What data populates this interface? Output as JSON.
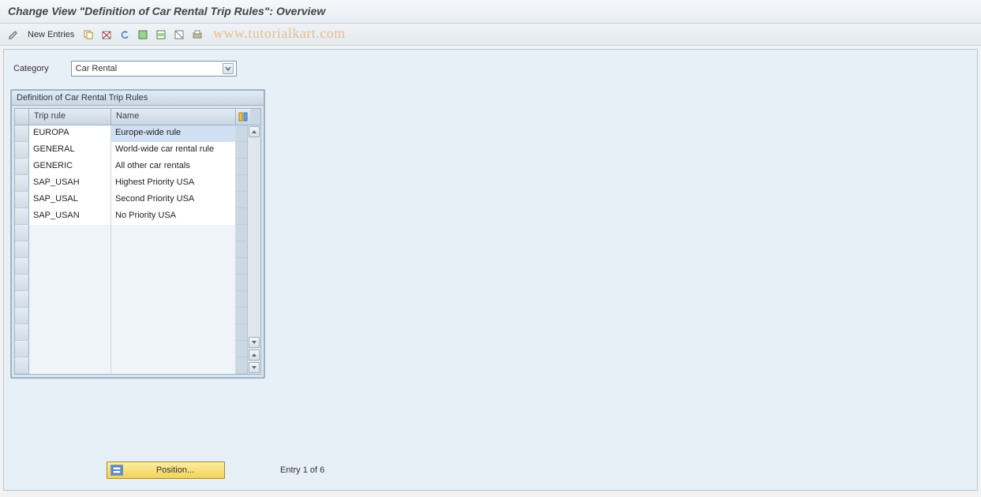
{
  "title": "Change View \"Definition of Car Rental Trip Rules\": Overview",
  "toolbar": {
    "new_entries": "New Entries"
  },
  "watermark": "www.tutorialkart.com",
  "category": {
    "label": "Category",
    "value": "Car Rental"
  },
  "panel": {
    "title": "Definition of Car Rental Trip Rules",
    "columns": {
      "rule": "Trip rule",
      "name": "Name"
    },
    "rows": [
      {
        "rule": "EUROPA",
        "name": "Europe-wide rule",
        "selected": true
      },
      {
        "rule": "GENERAL",
        "name": "World-wide car rental rule"
      },
      {
        "rule": "GENERIC",
        "name": "All other car rentals"
      },
      {
        "rule": "SAP_USAH",
        "name": "Highest Priority USA"
      },
      {
        "rule": "SAP_USAL",
        "name": "Second Priority USA"
      },
      {
        "rule": "SAP_USAN",
        "name": "No Priority USA"
      }
    ],
    "empty_rows": 9
  },
  "footer": {
    "position_label": "Position...",
    "entry_text": "Entry 1 of 6"
  }
}
